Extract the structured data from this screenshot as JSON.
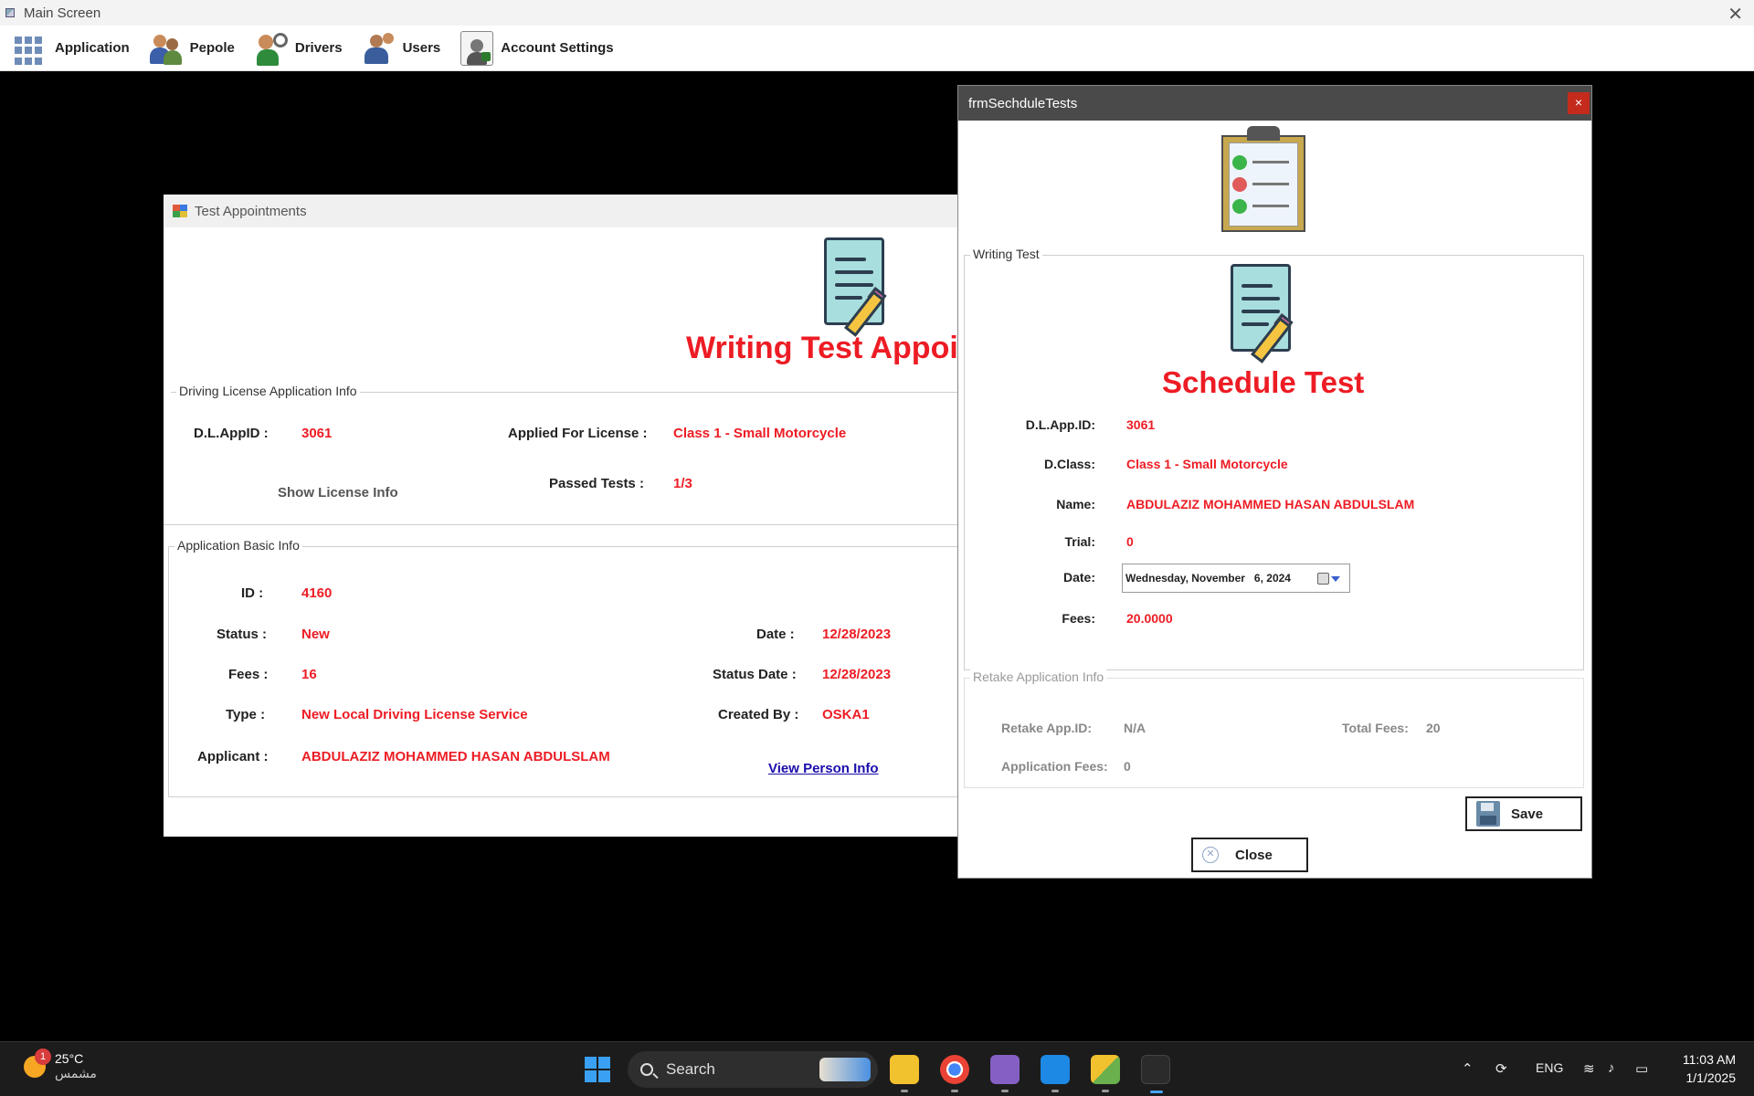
{
  "main_window": {
    "title": "Main Screen"
  },
  "menu": {
    "items": [
      {
        "label": "Application",
        "icon": "apps-grid-icon"
      },
      {
        "label": "Pepole",
        "icon": "people-icon"
      },
      {
        "label": "Drivers",
        "icon": "driver-icon"
      },
      {
        "label": "Users",
        "icon": "users-icon"
      },
      {
        "label": "Account Settings",
        "icon": "account-settings-icon"
      }
    ]
  },
  "appointments_window": {
    "title": "Test Appointments",
    "heading": "Writing Test Appoi",
    "dl_group": {
      "legend": "Driving License Application Info",
      "dl_app_id_label": "D.L.AppID :",
      "dl_app_id": "3061",
      "applied_for_label": "Applied For License :",
      "applied_for": "Class 1 - Small Motorcycle",
      "show_license_info": "Show License Info",
      "passed_tests_label": "Passed Tests :",
      "passed_tests": "1/3"
    },
    "basic_group": {
      "legend": "Application Basic Info",
      "id_label": "ID :",
      "id": "4160",
      "status_label": "Status :",
      "status": "New",
      "date_label": "Date :",
      "date": "12/28/2023",
      "fees_label": "Fees :",
      "fees": "16",
      "status_date_label": "Status Date :",
      "status_date": "12/28/2023",
      "type_label": "Type :",
      "type": "New Local Driving License Service",
      "created_by_label": "Created By :",
      "created_by": "OSKA1",
      "applicant_label": "Applicant :",
      "applicant": "ABDULAZIZ MOHAMMED HASAN ABDULSLAM",
      "view_person_info": "View Person Info"
    }
  },
  "schedule_window": {
    "title": "frmSechduleTests",
    "close_x": "×",
    "writing_group": {
      "legend": "Writing Test",
      "heading": "Schedule Test",
      "dl_app_id_label": "D.L.App.ID:",
      "dl_app_id": "3061",
      "dclass_label": "D.Class:",
      "dclass": "Class 1 - Small Motorcycle",
      "name_label": "Name:",
      "name": "ABDULAZIZ MOHAMMED HASAN ABDULSLAM",
      "trial_label": "Trial:",
      "trial": "0",
      "date_label": "Date:",
      "date_value": "Wednesday, November   6, 2024",
      "fees_label": "Fees:",
      "fees": "20.0000"
    },
    "retake_group": {
      "legend": "Retake Application Info",
      "retake_id_label": "Retake App.ID:",
      "retake_id": "N/A",
      "total_fees_label": "Total Fees:",
      "total_fees": "20",
      "app_fees_label": "Application Fees:",
      "app_fees": "0"
    },
    "save_label": "Save",
    "close_label": "Close"
  },
  "taskbar": {
    "weather_temp": "25°C",
    "weather_desc": "مشمس",
    "weather_badge": "1",
    "search_placeholder": "Search",
    "language": "ENG",
    "time": "11:03 AM",
    "date": "1/1/2025"
  }
}
